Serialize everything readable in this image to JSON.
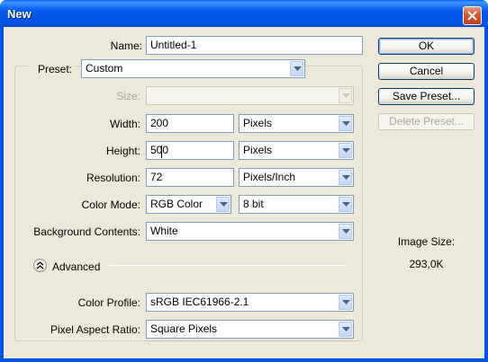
{
  "window": {
    "title": "New"
  },
  "name_field": {
    "label": "Name:",
    "value": "Untitled-1"
  },
  "preset": {
    "label": "Preset:",
    "value": "Custom"
  },
  "size": {
    "label": "Size:",
    "value": ""
  },
  "width": {
    "label": "Width:",
    "value": "200",
    "unit": "Pixels"
  },
  "height": {
    "label": "Height:",
    "value": "500",
    "unit": "Pixels"
  },
  "resolution": {
    "label": "Resolution:",
    "value": "72",
    "unit": "Pixels/Inch"
  },
  "color_mode": {
    "label": "Color Mode:",
    "value": "RGB Color",
    "depth": "8 bit"
  },
  "background": {
    "label": "Background Contents:",
    "value": "White"
  },
  "advanced": {
    "label": "Advanced"
  },
  "color_profile": {
    "label": "Color Profile:",
    "value": "sRGB IEC61966-2.1"
  },
  "pixel_aspect": {
    "label": "Pixel Aspect Ratio:",
    "value": "Square Pixels"
  },
  "buttons": {
    "ok": "OK",
    "cancel": "Cancel",
    "save_preset": "Save Preset...",
    "delete_preset": "Delete Preset..."
  },
  "image_size": {
    "label": "Image Size:",
    "value": "293,0K"
  },
  "colors": {
    "titlebar": "#0054e3",
    "dialog_bg": "#ece9d8",
    "field_border": "#7f9db9",
    "disabled_text": "#aca899"
  }
}
